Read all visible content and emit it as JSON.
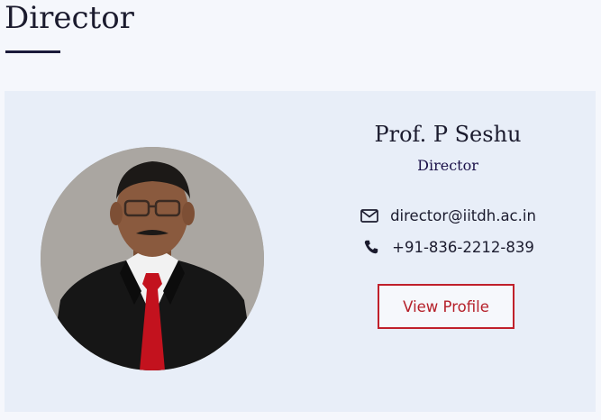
{
  "section": {
    "title": "Director"
  },
  "profile": {
    "name": "Prof. P Seshu",
    "role": "Director",
    "email": "director@iitdh.ac.in",
    "phone": "+91-836-2212-839",
    "button_label": "View Profile",
    "photo_icon": "person-portrait",
    "email_icon": "envelope-icon",
    "phone_icon": "phone-icon"
  },
  "colors": {
    "background": "#f5f7fc",
    "card": "#e8eef8",
    "accent_red": "#c0202b",
    "title_text": "#1b1b2e",
    "underline": "#1a1a3a"
  }
}
